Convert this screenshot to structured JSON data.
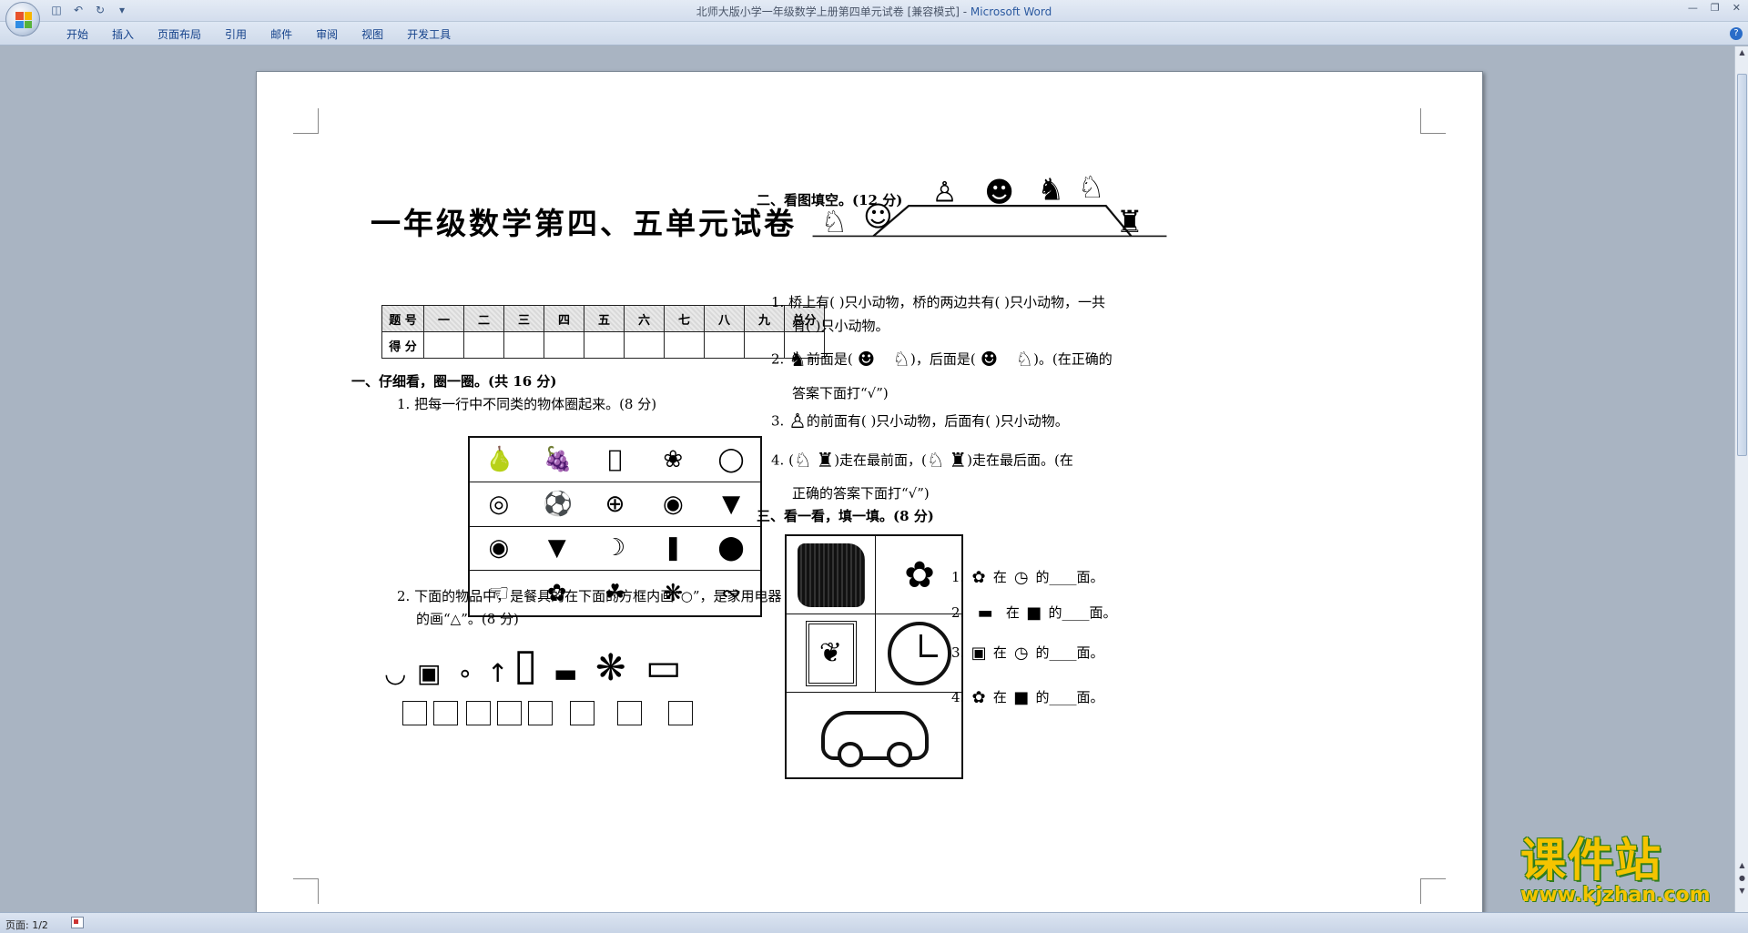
{
  "window": {
    "title_doc": "北师大版小学一年级数学上册第四单元试卷 [兼容模式] - ",
    "title_app": "Microsoft Word"
  },
  "ribbon": {
    "tabs": [
      "开始",
      "插入",
      "页面布局",
      "引用",
      "邮件",
      "审阅",
      "视图",
      "开发工具"
    ]
  },
  "doc": {
    "title": "一年级数学第四、五单元试卷",
    "score_table": {
      "row1": [
        "题 号",
        "一",
        "二",
        "三",
        "四",
        "五",
        "六",
        "七",
        "八",
        "九",
        "总分"
      ],
      "row2_label": "得 分"
    },
    "s1": {
      "heading": "一、仔细看，圈一圈。(共 16 分)",
      "q1": "1. 把每一行中不同类的物体圈起来。(8 分)",
      "q2_line1": "2. 下面的物品中，是餐具的在下面的方框内画“○”，是家用电器",
      "q2_line2": "的画“△”。(8 分)"
    },
    "s2": {
      "heading": "二、看图填空。(12 分)",
      "q1_line1": "1. 桥上有(      )只小动物，桥的两边共有(      )只小动物，一共",
      "q1_line2": "有(      )只小动物。",
      "q2_a": "2.",
      "q2_b": "前面是(",
      "q2_c": ")，后面是(",
      "q2_d": ")。(在正确的",
      "q2_line2": "答案下面打“√”)",
      "q3_a": "3.",
      "q3_b": "的前面有(      )只小动物，后面有(      )只小动物。",
      "q4_a": "4. (",
      "q4_b": ")走在最前面，(",
      "q4_c": ")走在最后面。(在",
      "q4_line2": "正确的答案下面打“√”)"
    },
    "s3": {
      "heading": "三、看一看，填一填。(8 分)",
      "q1_num": "1.",
      "q2_num": "2.",
      "q3_num": "3.",
      "q4_num": "4.",
      "word_zai": "在",
      "tail": "的____面。"
    }
  },
  "status": {
    "page": "页面: 1/2"
  },
  "watermark": {
    "cn": "课件站",
    "url": "www.kjzhan.com"
  }
}
